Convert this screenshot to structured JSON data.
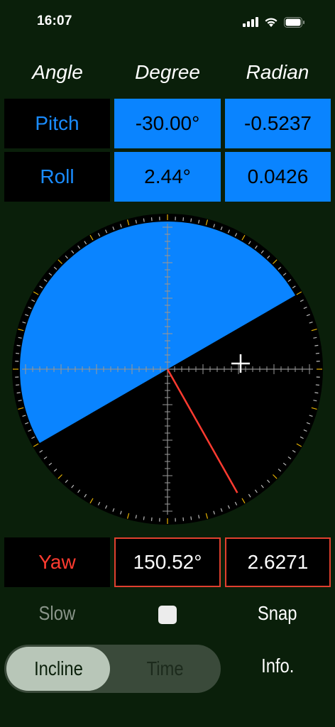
{
  "status": {
    "time": "16:07"
  },
  "headers": {
    "angle": "Angle",
    "degree": "Degree",
    "radian": "Radian"
  },
  "rows": {
    "pitch": {
      "label": "Pitch",
      "degree": "-30.00°",
      "radian": "-0.5237"
    },
    "roll": {
      "label": "Roll",
      "degree": "2.44°",
      "radian": "0.0426"
    },
    "yaw": {
      "label": "Yaw",
      "degree": "150.52°",
      "radian": "2.6271"
    }
  },
  "gauge": {
    "pitch_deg": -30.0,
    "roll_deg": 2.44,
    "yaw_deg": 150.52,
    "sky_color": "#0a84ff",
    "ground_color": "#000000",
    "yaw_needle_color": "#ff3b30"
  },
  "controls": {
    "slow": "Slow",
    "snap": "Snap",
    "info": "Info.",
    "mode_incline": "Incline",
    "mode_time": "Time",
    "selected_mode": "Incline"
  },
  "colors": {
    "accent": "#0a84ff",
    "background": "#0a1f0a",
    "yaw": "#ff3b30"
  }
}
